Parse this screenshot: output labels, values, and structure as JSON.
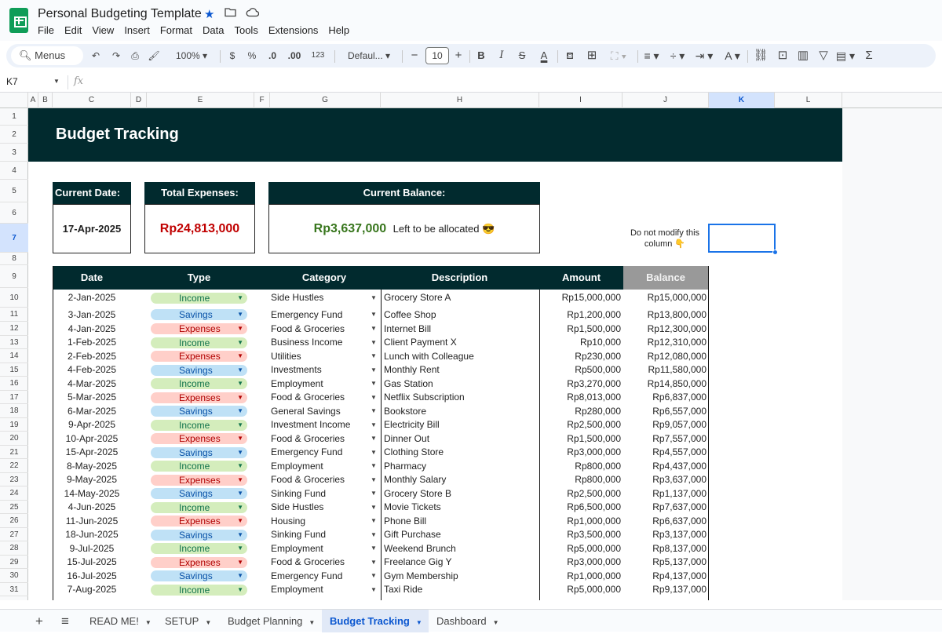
{
  "app": {
    "doc_title": "Personal Budgeting Template",
    "menu": [
      "File",
      "Edit",
      "View",
      "Insert",
      "Format",
      "Data",
      "Tools",
      "Extensions",
      "Help"
    ],
    "colors": {
      "sheets_green": "#0f9d58",
      "banner": "#012a2e",
      "accent_blue": "#0b57d0"
    }
  },
  "toolbar": {
    "menus_label": "Menus",
    "zoom": "100%",
    "currency": "$",
    "percent": "%",
    "dec_minus": ".0",
    "dec_plus": ".00",
    "number_format": "123",
    "font": "Defaul...",
    "font_size": "10",
    "bold": "B",
    "italic": "I",
    "strike": "S",
    "text_color": "A",
    "sum": "Σ"
  },
  "formula_bar": {
    "cell_ref": "K7",
    "fx": "fx"
  },
  "columns": [
    "A",
    "B",
    "C",
    "D",
    "E",
    "F",
    "G",
    "H",
    "I",
    "J",
    "K",
    "L"
  ],
  "selected_column": "K",
  "rows": [
    "1",
    "2",
    "3",
    "4",
    "5",
    "6",
    "7",
    "8",
    "9",
    "10",
    "11",
    "12",
    "13",
    "14",
    "15",
    "16",
    "17",
    "18",
    "19",
    "20",
    "21",
    "22",
    "23",
    "24",
    "25",
    "26",
    "27",
    "28",
    "29",
    "30",
    "31"
  ],
  "selected_row": "7",
  "sheet": {
    "banner_title": "Budget Tracking",
    "cards": {
      "current_date_label": "Current Date:",
      "current_date_value": "17-Apr-2025",
      "total_expenses_label": "Total Expenses:",
      "total_expenses_value": "Rp24,813,000",
      "current_balance_label": "Current Balance:",
      "current_balance_value": "Rp3,637,000",
      "current_balance_note": "Left to be allocated 😎"
    },
    "note": "Do not modify this column 👇",
    "table_headers": {
      "date": "Date",
      "type": "Type",
      "category": "Category",
      "description": "Description",
      "amount": "Amount",
      "balance": "Balance"
    },
    "transactions": [
      {
        "date": "2-Jan-2025",
        "type": "Income",
        "category": "Side Hustles",
        "description": "Grocery Store A",
        "amount": "Rp15,000,000",
        "balance": "Rp15,000,000"
      },
      {
        "date": "3-Jan-2025",
        "type": "Savings",
        "category": "Emergency Fund",
        "description": "Coffee Shop",
        "amount": "Rp1,200,000",
        "balance": "Rp13,800,000"
      },
      {
        "date": "4-Jan-2025",
        "type": "Expenses",
        "category": "Food & Groceries",
        "description": "Internet Bill",
        "amount": "Rp1,500,000",
        "balance": "Rp12,300,000"
      },
      {
        "date": "1-Feb-2025",
        "type": "Income",
        "category": "Business Income",
        "description": "Client Payment X",
        "amount": "Rp10,000",
        "balance": "Rp12,310,000"
      },
      {
        "date": "2-Feb-2025",
        "type": "Expenses",
        "category": "Utilities",
        "description": "Lunch with Colleague",
        "amount": "Rp230,000",
        "balance": "Rp12,080,000"
      },
      {
        "date": "4-Feb-2025",
        "type": "Savings",
        "category": "Investments",
        "description": "Monthly Rent",
        "amount": "Rp500,000",
        "balance": "Rp11,580,000"
      },
      {
        "date": "4-Mar-2025",
        "type": "Income",
        "category": "Employment",
        "description": "Gas Station",
        "amount": "Rp3,270,000",
        "balance": "Rp14,850,000"
      },
      {
        "date": "5-Mar-2025",
        "type": "Expenses",
        "category": "Food & Groceries",
        "description": "Netflix Subscription",
        "amount": "Rp8,013,000",
        "balance": "Rp6,837,000"
      },
      {
        "date": "6-Mar-2025",
        "type": "Savings",
        "category": "General Savings",
        "description": "Bookstore",
        "amount": "Rp280,000",
        "balance": "Rp6,557,000"
      },
      {
        "date": "9-Apr-2025",
        "type": "Income",
        "category": "Investment Income",
        "description": "Electricity Bill",
        "amount": "Rp2,500,000",
        "balance": "Rp9,057,000"
      },
      {
        "date": "10-Apr-2025",
        "type": "Expenses",
        "category": "Food & Groceries",
        "description": "Dinner Out",
        "amount": "Rp1,500,000",
        "balance": "Rp7,557,000"
      },
      {
        "date": "15-Apr-2025",
        "type": "Savings",
        "category": "Emergency Fund",
        "description": "Clothing Store",
        "amount": "Rp3,000,000",
        "balance": "Rp4,557,000"
      },
      {
        "date": "8-May-2025",
        "type": "Income",
        "category": "Employment",
        "description": "Pharmacy",
        "amount": "Rp800,000",
        "balance": "Rp4,437,000"
      },
      {
        "date": "9-May-2025",
        "type": "Expenses",
        "category": "Food & Groceries",
        "description": "Monthly Salary",
        "amount": "Rp800,000",
        "balance": "Rp3,637,000"
      },
      {
        "date": "14-May-2025",
        "type": "Savings",
        "category": "Sinking Fund",
        "description": "Grocery Store B",
        "amount": "Rp2,500,000",
        "balance": "Rp1,137,000"
      },
      {
        "date": "4-Jun-2025",
        "type": "Income",
        "category": "Side Hustles",
        "description": "Movie Tickets",
        "amount": "Rp6,500,000",
        "balance": "Rp7,637,000"
      },
      {
        "date": "11-Jun-2025",
        "type": "Expenses",
        "category": "Housing",
        "description": "Phone Bill",
        "amount": "Rp1,000,000",
        "balance": "Rp6,637,000"
      },
      {
        "date": "18-Jun-2025",
        "type": "Savings",
        "category": "Sinking Fund",
        "description": "Gift Purchase",
        "amount": "Rp3,500,000",
        "balance": "Rp3,137,000"
      },
      {
        "date": "9-Jul-2025",
        "type": "Income",
        "category": "Employment",
        "description": "Weekend Brunch",
        "amount": "Rp5,000,000",
        "balance": "Rp8,137,000"
      },
      {
        "date": "15-Jul-2025",
        "type": "Expenses",
        "category": "Food & Groceries",
        "description": "Freelance Gig Y",
        "amount": "Rp3,000,000",
        "balance": "Rp5,137,000"
      },
      {
        "date": "16-Jul-2025",
        "type": "Savings",
        "category": "Emergency Fund",
        "description": "Gym Membership",
        "amount": "Rp1,000,000",
        "balance": "Rp4,137,000"
      },
      {
        "date": "7-Aug-2025",
        "type": "Income",
        "category": "Employment",
        "description": "Taxi Ride",
        "amount": "Rp5,000,000",
        "balance": "Rp9,137,000"
      }
    ]
  },
  "tabs": [
    {
      "label": "READ ME!"
    },
    {
      "label": "SETUP"
    },
    {
      "label": "Budget Planning"
    },
    {
      "label": "Budget Tracking",
      "active": true
    },
    {
      "label": "Dashboard"
    }
  ]
}
